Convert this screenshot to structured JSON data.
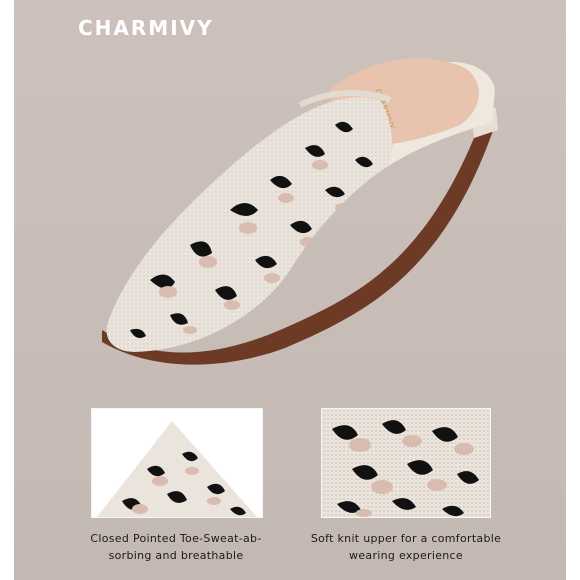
{
  "brand": {
    "name": "CHARMIVY",
    "insole_print": "CHARMIVY"
  },
  "colors": {
    "background": "#c8bcb7",
    "knit_base": "#e9e2da",
    "spot_black": "#111111",
    "spot_pink": "#d8bcb0",
    "insole": "#e8c3ad"
  },
  "features": [
    {
      "caption_line1": "Closed Pointed Toe-Sweat-ab-",
      "caption_line2": "sorbing and breathable",
      "icon": "pointed-toe-closeup"
    },
    {
      "caption_line1": "Soft knit upper for a comfortable",
      "caption_line2": "wearing experience",
      "icon": "knit-texture-closeup"
    }
  ]
}
